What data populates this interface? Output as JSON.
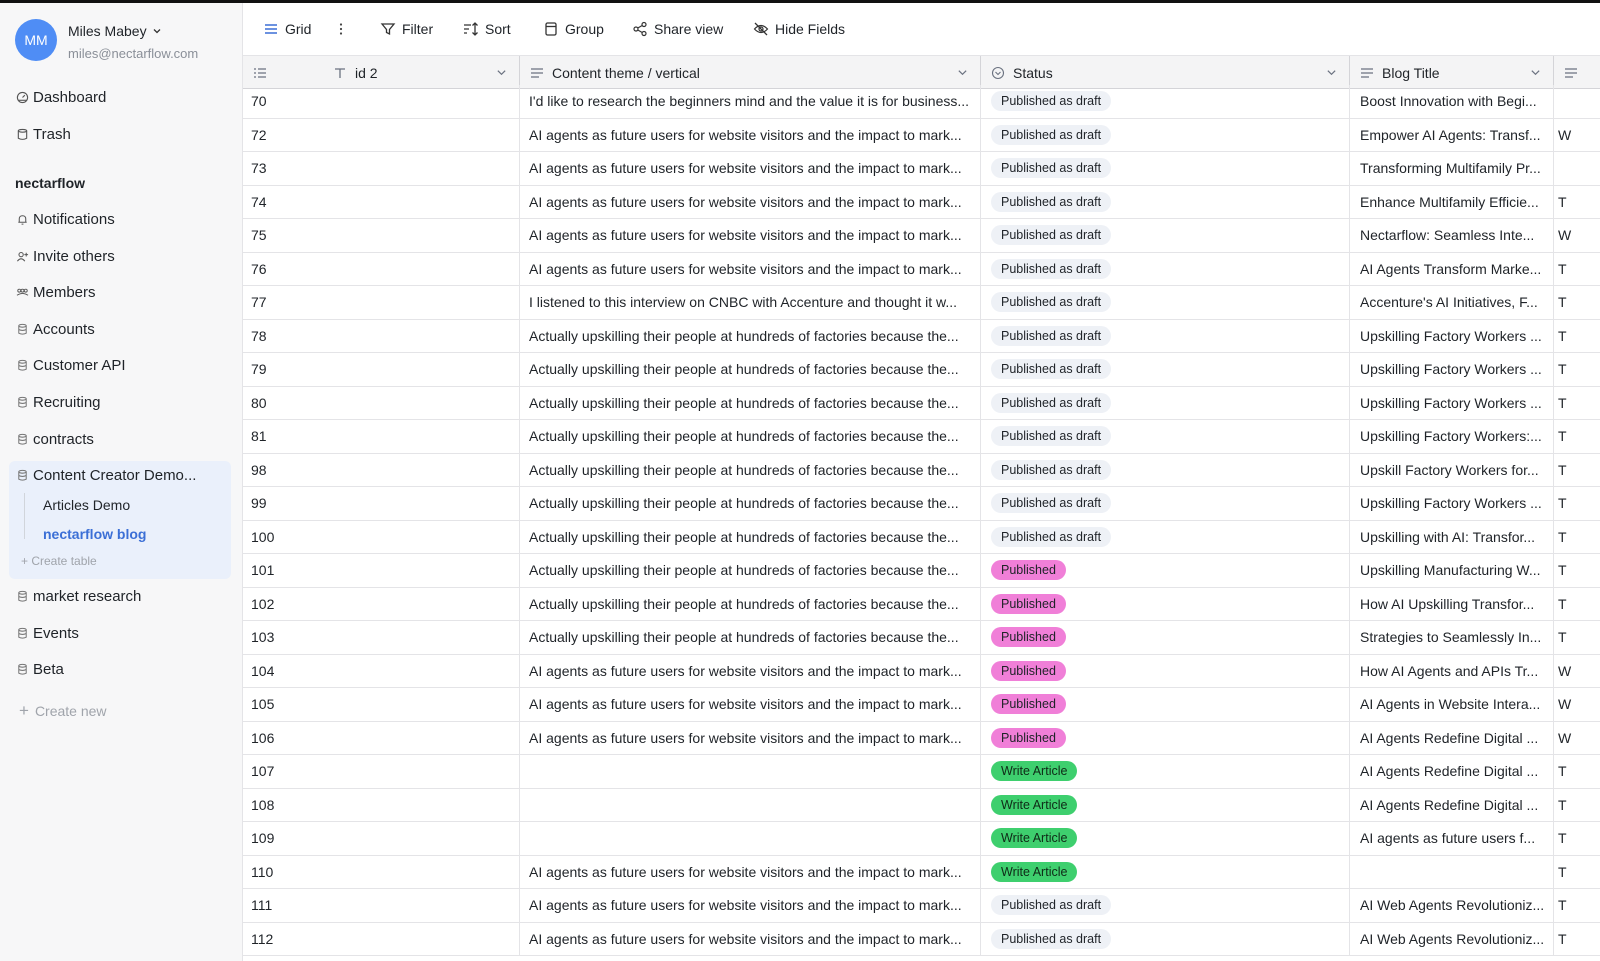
{
  "user": {
    "initials": "MM",
    "name": "Miles Mabey",
    "email": "miles@nectarflow.com"
  },
  "nav_top": [
    {
      "label": "Dashboard",
      "icon": "dashboard-icon"
    },
    {
      "label": "Trash",
      "icon": "trash-icon"
    }
  ],
  "workspace": {
    "title": "nectarflow",
    "items": [
      {
        "label": "Notifications",
        "icon": "bell-icon"
      },
      {
        "label": "Invite others",
        "icon": "invite-icon"
      },
      {
        "label": "Members",
        "icon": "members-icon"
      },
      {
        "label": "Accounts",
        "icon": "database-icon"
      },
      {
        "label": "Customer API",
        "icon": "database-icon"
      },
      {
        "label": "Recruiting",
        "icon": "database-icon"
      },
      {
        "label": "contracts",
        "icon": "database-icon"
      }
    ],
    "open_base": {
      "label": "Content Creator Demo...",
      "tables": [
        "Articles Demo",
        "nectarflow blog"
      ],
      "active_table": "nectarflow blog",
      "create_table": "+ Create table"
    },
    "items_after": [
      {
        "label": "market research",
        "icon": "database-icon"
      },
      {
        "label": "Events",
        "icon": "database-icon"
      },
      {
        "label": "Beta",
        "icon": "database-icon"
      }
    ],
    "create_new": "Create new"
  },
  "toolbar": {
    "grid": "Grid",
    "filter": "Filter",
    "sort": "Sort",
    "group": "Group",
    "share": "Share view",
    "hide": "Hide Fields"
  },
  "columns": {
    "id": "id 2",
    "theme": "Content theme / vertical",
    "status": "Status",
    "title": "Blog Title"
  },
  "status_colors": {
    "Published as draft": "#eef1f6",
    "Published": "#f07fd8",
    "Write Article": "#3ecf6e"
  },
  "rows": [
    {
      "id": "70",
      "theme": "I'd like to research the beginners mind and the value it is for business...",
      "status": "Published as draft",
      "title": "Boost Innovation with Begi...",
      "extra": ""
    },
    {
      "id": "72",
      "theme": "AI agents as future users for website visitors and the impact to mark...",
      "status": "Published as draft",
      "title": "Empower AI Agents: Transf...",
      "extra": "W"
    },
    {
      "id": "73",
      "theme": "AI agents as future users for website visitors and the impact to mark...",
      "status": "Published as draft",
      "title": "Transforming Multifamily Pr...",
      "extra": ""
    },
    {
      "id": "74",
      "theme": "AI agents as future users for website visitors and the impact to mark...",
      "status": "Published as draft",
      "title": "Enhance Multifamily Efficie...",
      "extra": "T"
    },
    {
      "id": "75",
      "theme": "AI agents as future users for website visitors and the impact to mark...",
      "status": "Published as draft",
      "title": "Nectarflow: Seamless Inte...",
      "extra": "W"
    },
    {
      "id": "76",
      "theme": "AI agents as future users for website visitors and the impact to mark...",
      "status": "Published as draft",
      "title": "AI Agents Transform Marke...",
      "extra": "T"
    },
    {
      "id": "77",
      "theme": "I listened to this interview on CNBC with Accenture and thought it w...",
      "status": "Published as draft",
      "title": "Accenture's AI Initiatives, F...",
      "extra": "T"
    },
    {
      "id": "78",
      "theme": "Actually upskilling their people at hundreds of factories because the...",
      "status": "Published as draft",
      "title": "Upskilling Factory Workers ...",
      "extra": "T"
    },
    {
      "id": "79",
      "theme": "Actually upskilling their people at hundreds of factories because the...",
      "status": "Published as draft",
      "title": "Upskilling Factory Workers ...",
      "extra": "T"
    },
    {
      "id": "80",
      "theme": "Actually upskilling their people at hundreds of factories because the...",
      "status": "Published as draft",
      "title": "Upskilling Factory Workers ...",
      "extra": "T"
    },
    {
      "id": "81",
      "theme": "Actually upskilling their people at hundreds of factories because the...",
      "status": "Published as draft",
      "title": "Upskilling Factory Workers:...",
      "extra": "T"
    },
    {
      "id": "98",
      "theme": "Actually upskilling their people at hundreds of factories because the...",
      "status": "Published as draft",
      "title": "Upskill Factory Workers for...",
      "extra": "T"
    },
    {
      "id": "99",
      "theme": "Actually upskilling their people at hundreds of factories because the...",
      "status": "Published as draft",
      "title": "Upskilling Factory Workers ...",
      "extra": "T"
    },
    {
      "id": "100",
      "theme": "Actually upskilling their people at hundreds of factories because the...",
      "status": "Published as draft",
      "title": "Upskilling with AI: Transfor...",
      "extra": "T"
    },
    {
      "id": "101",
      "theme": "Actually upskilling their people at hundreds of factories because the...",
      "status": "Published",
      "title": "Upskilling Manufacturing W...",
      "extra": "T"
    },
    {
      "id": "102",
      "theme": "Actually upskilling their people at hundreds of factories because the...",
      "status": "Published",
      "title": "How AI Upskilling Transfor...",
      "extra": "T"
    },
    {
      "id": "103",
      "theme": "Actually upskilling their people at hundreds of factories because the...",
      "status": "Published",
      "title": "Strategies to Seamlessly In...",
      "extra": "T"
    },
    {
      "id": "104",
      "theme": "AI agents as future users for website visitors and the impact to mark...",
      "status": "Published",
      "title": "How AI Agents and APIs Tr...",
      "extra": "W"
    },
    {
      "id": "105",
      "theme": "AI agents as future users for website visitors and the impact to mark...",
      "status": "Published",
      "title": "AI Agents in Website Intera...",
      "extra": "W"
    },
    {
      "id": "106",
      "theme": "AI agents as future users for website visitors and the impact to mark...",
      "status": "Published",
      "title": "AI Agents Redefine Digital ...",
      "extra": "W"
    },
    {
      "id": "107",
      "theme": "",
      "status": "Write Article",
      "title": "AI Agents Redefine Digital ...",
      "extra": "T"
    },
    {
      "id": "108",
      "theme": "",
      "status": "Write Article",
      "title": "AI Agents Redefine Digital ...",
      "extra": "T"
    },
    {
      "id": "109",
      "theme": "",
      "status": "Write Article",
      "title": "AI agents as future users f...",
      "extra": "T"
    },
    {
      "id": "110",
      "theme": "AI agents as future users for website visitors and the impact to mark...",
      "status": "Write Article",
      "title": "",
      "extra": "T"
    },
    {
      "id": "111",
      "theme": "AI agents as future users for website visitors and the impact to mark...",
      "status": "Published as draft",
      "title": "AI Web Agents Revolutioniz...",
      "extra": "T"
    },
    {
      "id": "112",
      "theme": "AI agents as future users for website visitors and the impact to mark...",
      "status": "Published as draft",
      "title": "AI Web Agents Revolutioniz...",
      "extra": "T"
    }
  ]
}
